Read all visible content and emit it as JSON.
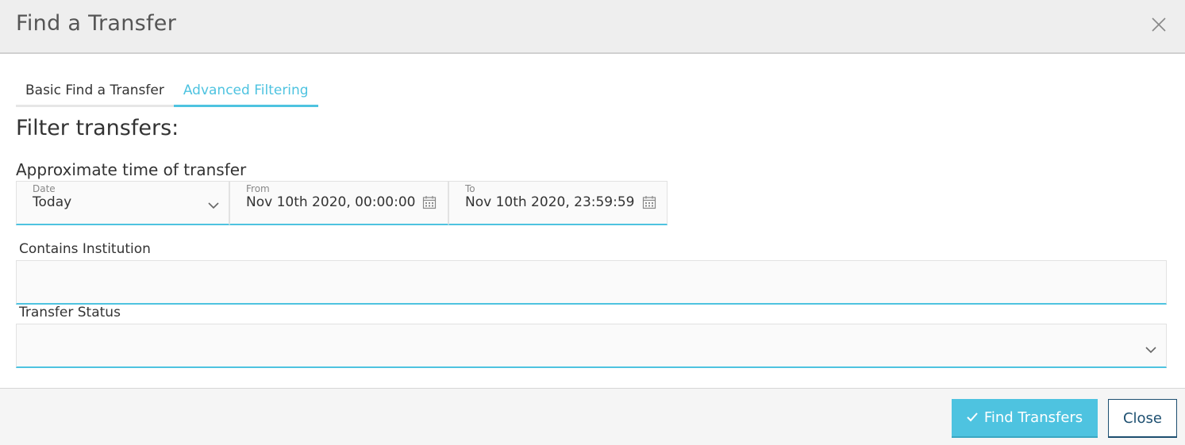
{
  "dialog": {
    "title": "Find a Transfer",
    "close_icon": "close-icon"
  },
  "tabs": [
    {
      "label": "Basic Find a Transfer",
      "active": false
    },
    {
      "label": "Advanced Filtering",
      "active": true
    }
  ],
  "filter_title": "Filter transfers:",
  "time_section": {
    "label": "Approximate time of transfer",
    "date": {
      "label": "Date",
      "value": "Today",
      "icon": "chevron-down-icon"
    },
    "from": {
      "label": "From",
      "value": "Nov 10th 2020, 00:00:00",
      "icon": "calendar-icon"
    },
    "to": {
      "label": "To",
      "value": "Nov 10th 2020, 23:59:59",
      "icon": "calendar-icon"
    }
  },
  "institution": {
    "label": "Contains Institution",
    "value": ""
  },
  "status": {
    "label": "Transfer Status",
    "value": "",
    "icon": "chevron-down-icon"
  },
  "footer": {
    "find_label": "Find Transfers",
    "find_icon": "checkmark-icon",
    "close_label": "Close"
  },
  "colors": {
    "accent": "#4ec3e0",
    "secondary_border": "#1d4f70",
    "header_bg": "#eeeeee"
  }
}
